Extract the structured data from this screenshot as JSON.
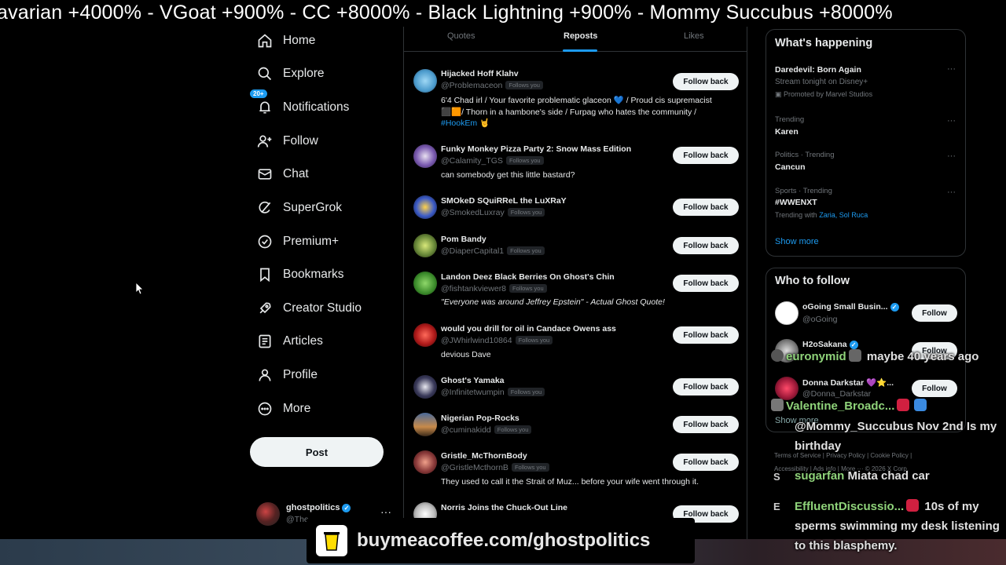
{
  "ticker": {
    "text": "avarian +4000%   -  VGoat +900%   -  CC +8000%   -  Black Lightning +900%   -  Mommy Succubus +8000%"
  },
  "nav": {
    "items": [
      {
        "label": "Home",
        "icon": "home-icon"
      },
      {
        "label": "Explore",
        "icon": "search-icon"
      },
      {
        "label": "Notifications",
        "icon": "bell-icon",
        "badge": "20+"
      },
      {
        "label": "Follow",
        "icon": "add-person-icon"
      },
      {
        "label": "Chat",
        "icon": "mail-icon"
      },
      {
        "label": "SuperGrok",
        "icon": "grok-icon"
      },
      {
        "label": "Premium+",
        "icon": "verified-icon"
      },
      {
        "label": "Bookmarks",
        "icon": "bookmark-icon"
      },
      {
        "label": "Creator Studio",
        "icon": "rocket-icon"
      },
      {
        "label": "Articles",
        "icon": "article-icon"
      },
      {
        "label": "Profile",
        "icon": "person-icon"
      },
      {
        "label": "More",
        "icon": "more-circle-icon"
      }
    ],
    "post_label": "Post"
  },
  "account": {
    "name": "ghostpolitics",
    "handle": "@The"
  },
  "tabs": {
    "quotes": "Quotes",
    "reposts": "Reposts",
    "likes": "Likes"
  },
  "follows_you": "Follows you",
  "follow_back": "Follow back",
  "users": [
    {
      "name": "Hijacked Hoff Klahv",
      "handle": "@Problemaceon",
      "bio1": "6'4 Chad irl / Your favorite problematic glaceon 💙 / Proud cis supremacist",
      "bio2": "⬛🟧/ Thorn in a hambone's side / Furpag who hates the community /",
      "bio3_link": "#HookEm",
      "bio3_rest": " 🤘"
    },
    {
      "name": "Funky Monkey Pizza Party 2: Snow Mass Edition",
      "handle": "@Calamity_TGS",
      "bio1": "can somebody get this little bastard?"
    },
    {
      "name": "SMOkeD SQuiRReL the LuXRaY",
      "handle": "@SmokedLuxray"
    },
    {
      "name": "Pom Bandy",
      "handle": "@DiaperCapital1"
    },
    {
      "name": "Landon Deez Black Berries On Ghost's Chin",
      "handle": "@fishtankviewer8",
      "bio1": "\"Everyone was around Jeffrey Epstein\" - Actual Ghost Quote!"
    },
    {
      "name": "would you drill for oil in Candace Owens ass",
      "handle": "@JWhirlwind10864",
      "bio1": "devious Dave"
    },
    {
      "name": "Ghost's Yamaka",
      "handle": "@Infinitetwumpin"
    },
    {
      "name": "Nigerian Pop-Rocks",
      "handle": "@cuminakidd"
    },
    {
      "name": "Gristle_McThornBody",
      "handle": "@GristleMcthornB",
      "bio1": "They used to call it the Strait of Muz... before your wife went through it."
    },
    {
      "name": "Norris Joins the Chuck-Out Line",
      "handle": ""
    }
  ],
  "happening": {
    "title": "What's happening",
    "trends": [
      {
        "meta": "",
        "title": "Daredevil: Born Again",
        "sub": "Stream tonight on Disney+",
        "promo": "Promoted by Marvel Studios"
      },
      {
        "meta": "Trending",
        "title": "Karen"
      },
      {
        "meta": "Politics · Trending",
        "title": "Cancun"
      },
      {
        "meta": "Sports · Trending",
        "title": "#WWENXT",
        "sub_prefix": "Trending with ",
        "sub_link": "Zaria, Sol Ruca"
      }
    ],
    "show_more": "Show more"
  },
  "who_to_follow": {
    "title": "Who to follow",
    "follow_label": "Follow",
    "accounts": [
      {
        "name": "oGoing Small Busin...",
        "handle": "@oGoing"
      },
      {
        "name": "H2oSakana",
        "handle": ""
      },
      {
        "name": "Donna Darkstar 💜⭐...",
        "handle": "@Donna_Darkstar"
      }
    ],
    "show_more": "Show more"
  },
  "footer": {
    "line1": "Terms of Service  |  Privacy Policy  |  Cookie Policy  |",
    "line2": "Accessibility  |  Ads info  |  More ···  © 2026 X Corp."
  },
  "chat": [
    {
      "name": "euronymid",
      "msg": " maybe 40 years ago"
    },
    {
      "name": "Valentine_Broadc...",
      "msg": ""
    },
    {
      "name": "",
      "msg": "@Mommy_Succubus Nov 2nd Is my birthday"
    },
    {
      "initial": "S",
      "name": "sugarfan",
      "msg": " Miata chad car"
    },
    {
      "initial": "E",
      "name": "EffluentDiscussio...",
      "msg": " 10s of my sperms swimming my desk listening to this blasphemy."
    }
  ],
  "banner": {
    "text": "buymeacoffee.com/ghostpolitics"
  },
  "colors": {
    "accent": "#1d9bf0",
    "background": "#000000",
    "chat_name": "#8fd37a"
  }
}
